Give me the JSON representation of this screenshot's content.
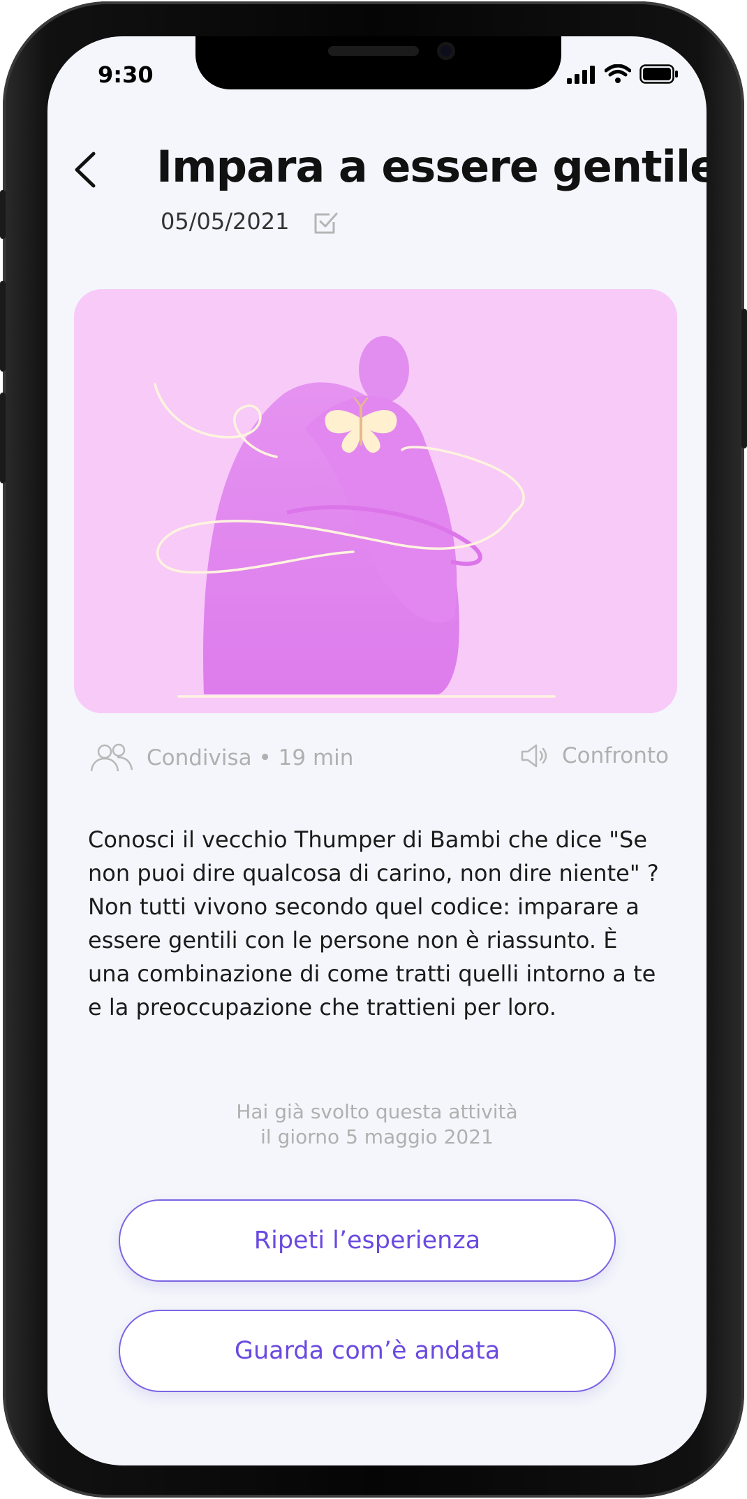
{
  "status_bar": {
    "time": "9:30"
  },
  "header": {
    "title": "Impara a essere gentile",
    "date": "05/05/2021"
  },
  "meta": {
    "mode_duration": "Condivisa • 19 min",
    "category": "Confronto"
  },
  "description": "Conosci il vecchio Thumper di Bambi che dice \"Se non puoi dire qualcosa di carino, non dire niente\" ? Non tutti vivono secondo quel codice: imparare a essere gentili con le persone non è riassunto. È una combinazione di come tratti quelli intorno a te e la preoccupazione che trattieni per loro.",
  "completion_note": {
    "line1": "Hai già svolto questa attività",
    "line2": "il giorno 5 maggio 2021"
  },
  "buttons": {
    "repeat": "Ripeti l’esperienza",
    "review": "Guarda com’è andata"
  },
  "colors": {
    "accent": "#6a4ae0",
    "hero_bg": "#f7caf8",
    "figure": "#e183ee",
    "screen_bg": "#f4f6fb"
  }
}
